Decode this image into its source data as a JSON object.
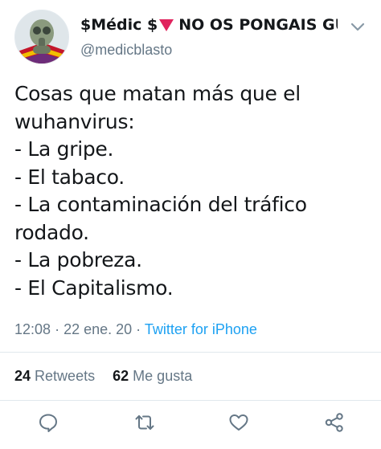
{
  "author": {
    "display_name": "$Médic $",
    "display_name_suffix": "NO OS PONGAIS GUA...",
    "username": "@medicblasto"
  },
  "tweet": {
    "text": "Cosas que matan más que el\nwuhanvirus:\n- La gripe.\n- El tabaco.\n- La contaminación del tráfico\nrodado.\n- La pobreza.\n- El Capitalismo.",
    "time": "12:08",
    "date": "22 ene. 20",
    "separator": "·",
    "source": "Twitter for iPhone"
  },
  "stats": {
    "retweets_count": "24",
    "retweets_label": "Retweets",
    "likes_count": "62",
    "likes_label": "Me gusta"
  },
  "icons": {
    "reply": "reply-icon",
    "retweet": "retweet-icon",
    "like": "heart-icon",
    "share": "share-icon",
    "menu": "chevron-down-icon"
  },
  "colors": {
    "text": "#14171a",
    "muted": "#657786",
    "link": "#1da1f2",
    "flag_red": "#e0245e"
  }
}
